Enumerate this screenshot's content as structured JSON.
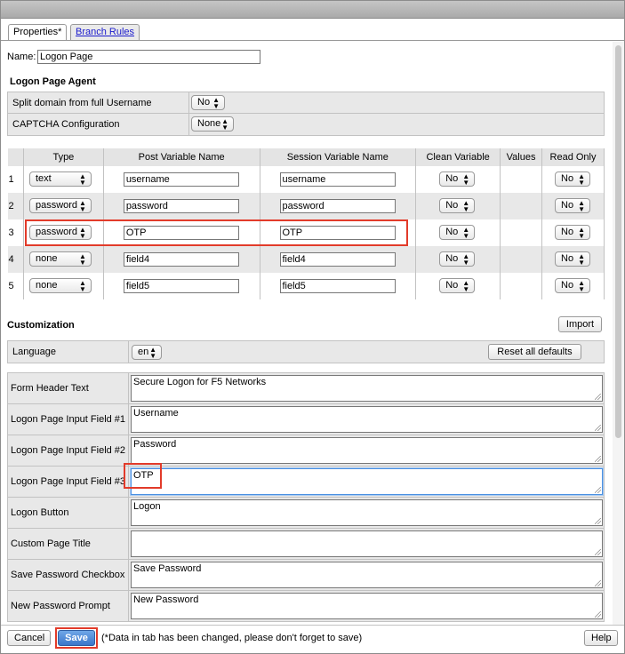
{
  "tabs": [
    {
      "label": "Properties*",
      "active": true
    },
    {
      "label": "Branch Rules",
      "active": false
    }
  ],
  "name_field": {
    "label": "Name:",
    "value": "Logon Page"
  },
  "agent": {
    "title": "Logon Page Agent",
    "rows": [
      {
        "label": "Split domain from full Username",
        "value": "No"
      },
      {
        "label": "CAPTCHA Configuration",
        "value": "None"
      }
    ]
  },
  "vars_table": {
    "headers": [
      "Type",
      "Post Variable Name",
      "Session Variable Name",
      "Clean Variable",
      "Values",
      "Read Only"
    ],
    "rows": [
      {
        "num": "1",
        "type": "text",
        "post": "username",
        "session": "username",
        "clean": "No",
        "readonly": "No"
      },
      {
        "num": "2",
        "type": "password",
        "post": "password",
        "session": "password",
        "clean": "No",
        "readonly": "No"
      },
      {
        "num": "3",
        "type": "password",
        "post": "OTP",
        "session": "OTP",
        "clean": "No",
        "readonly": "No"
      },
      {
        "num": "4",
        "type": "none",
        "post": "field4",
        "session": "field4",
        "clean": "No",
        "readonly": "No"
      },
      {
        "num": "5",
        "type": "none",
        "post": "field5",
        "session": "field5",
        "clean": "No",
        "readonly": "No"
      }
    ]
  },
  "customization": {
    "title": "Customization",
    "import_label": "Import",
    "language_label": "Language",
    "language_value": "en",
    "reset_label": "Reset all defaults",
    "fields": [
      {
        "label": "Form Header Text",
        "value": "Secure Logon for F5 Networks"
      },
      {
        "label": "Logon Page Input Field #1",
        "value": "Username"
      },
      {
        "label": "Logon Page Input Field #2",
        "value": "Password"
      },
      {
        "label": "Logon Page Input Field #3",
        "value": "OTP"
      },
      {
        "label": "Logon Button",
        "value": "Logon"
      },
      {
        "label": "Custom Page Title",
        "value": ""
      },
      {
        "label": "Save Password Checkbox",
        "value": "Save Password"
      },
      {
        "label": "New Password Prompt",
        "value": "New Password"
      }
    ]
  },
  "footer": {
    "cancel_label": "Cancel",
    "save_label": "Save",
    "notice": "(*Data in tab has been changed, please don't forget to save)",
    "help_label": "Help"
  },
  "colors": {
    "highlight": "#e23b2a",
    "save_button": "#3b76c9"
  }
}
